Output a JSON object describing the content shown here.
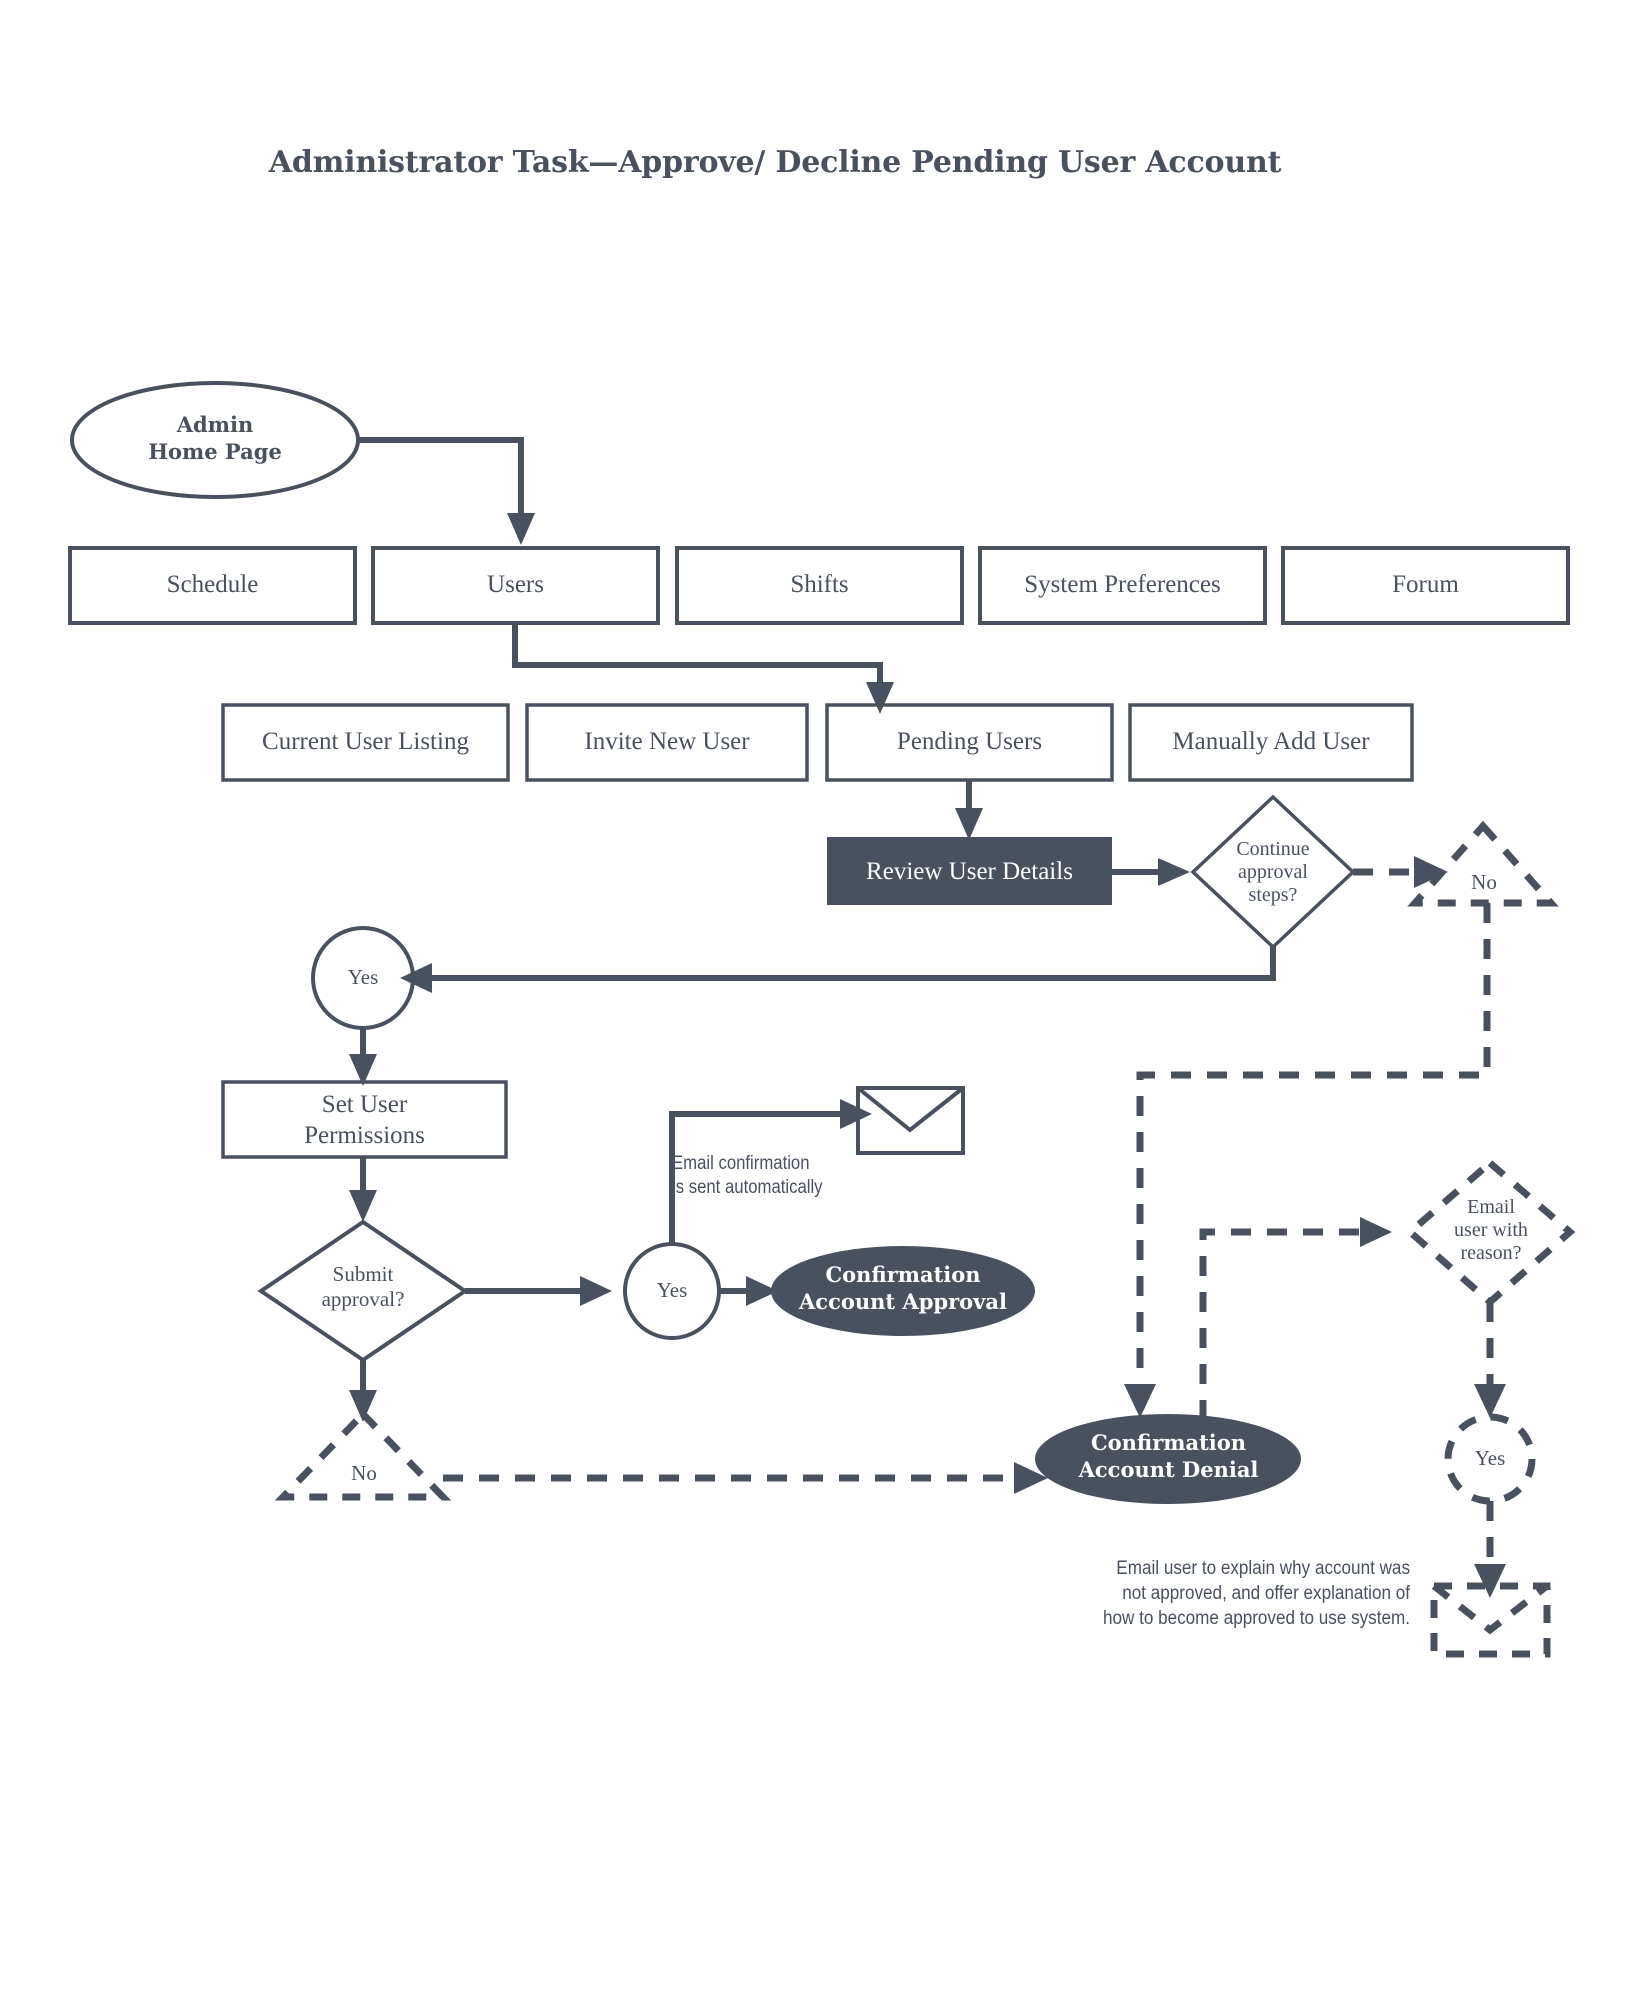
{
  "title": "Administrator Task—Approve/ Decline Pending User Account",
  "colors": {
    "ink": "#4a515e",
    "fill_dark": "#4a515e",
    "paper": "#ffffff",
    "text_on_dark": "#ffffff"
  },
  "nodes": {
    "start": {
      "label": "Admin\nHome Page",
      "shape": "ellipse"
    },
    "nav": [
      {
        "label": "Schedule",
        "shape": "rect"
      },
      {
        "label": "Users",
        "shape": "rect"
      },
      {
        "label": "Shifts",
        "shape": "rect"
      },
      {
        "label": "System Preferences",
        "shape": "rect"
      },
      {
        "label": "Forum",
        "shape": "rect"
      }
    ],
    "user_submenu": [
      {
        "label": "Current User Listing",
        "shape": "rect"
      },
      {
        "label": "Invite New User",
        "shape": "rect"
      },
      {
        "label": "Pending Users",
        "shape": "rect"
      },
      {
        "label": "Manually Add User",
        "shape": "rect"
      }
    ],
    "review": {
      "label": "Review User Details",
      "shape": "rect-filled"
    },
    "continue_decision": {
      "label": "Continue\napproval\nsteps?",
      "shape": "diamond"
    },
    "continue_no": {
      "label": "No",
      "shape": "triangle-dashed"
    },
    "continue_yes": {
      "label": "Yes",
      "shape": "circle"
    },
    "set_permissions": {
      "label": "Set User\nPermissions",
      "shape": "rect"
    },
    "submit_decision": {
      "label": "Submit\napproval?",
      "shape": "diamond"
    },
    "submit_yes": {
      "label": "Yes",
      "shape": "circle"
    },
    "submit_no": {
      "label": "No",
      "shape": "triangle-dashed"
    },
    "approval_result": {
      "label": "Confirmation\nAccount Approval",
      "shape": "ellipse-filled"
    },
    "denial_result": {
      "label": "Confirmation\nAccount Denial",
      "shape": "ellipse-filled"
    },
    "email_decision": {
      "label": "Email\nuser with\nreason?",
      "shape": "diamond-dashed"
    },
    "email_yes": {
      "label": "Yes",
      "shape": "circle-dashed"
    },
    "email_envelope_top": {
      "label": "",
      "shape": "envelope"
    },
    "email_envelope_bottom": {
      "label": "",
      "shape": "envelope-dashed"
    }
  },
  "annotations": {
    "auto_email": "Email confirmation\nis sent automatically",
    "denial_email": "Email user to explain why account was\nnot approved, and offer explanation of\nhow to become approved to use system."
  },
  "icons": {
    "envelope_top": "envelope-icon",
    "envelope_bottom": "envelope-dashed-icon"
  }
}
